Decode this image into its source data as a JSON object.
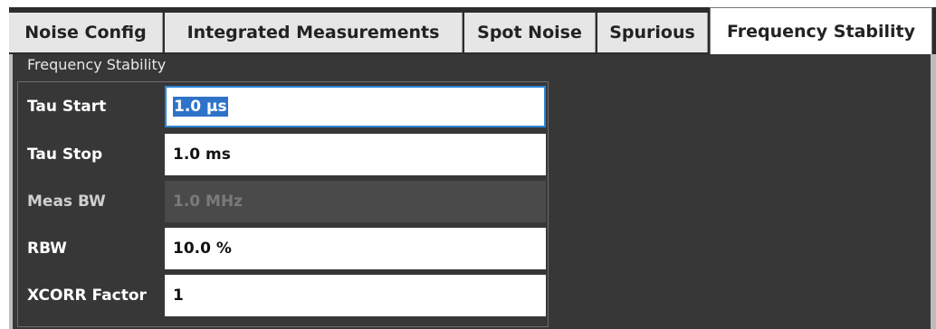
{
  "tabs": [
    {
      "label": "Noise Config"
    },
    {
      "label": "Integrated Measurements"
    },
    {
      "label": "Spot Noise"
    },
    {
      "label": "Spurious"
    },
    {
      "label": "Frequency Stability",
      "active": true
    }
  ],
  "group": {
    "title": "Frequency Stability",
    "fields": [
      {
        "label": "Tau Start",
        "value": "1.0 µs",
        "state": "focused-selected"
      },
      {
        "label": "Tau Stop",
        "value": "1.0 ms",
        "state": "normal"
      },
      {
        "label": "Meas BW",
        "value": "1.0 MHz",
        "state": "disabled"
      },
      {
        "label": "RBW",
        "value": "10.0 %",
        "state": "normal"
      },
      {
        "label": "XCORR Factor",
        "value": "1",
        "state": "normal"
      }
    ]
  },
  "colors": {
    "tabbar_bg": "#2c2c2c",
    "panel_bg": "#373737",
    "focus_border": "#2e86d6",
    "selection": "#2f73c8"
  }
}
